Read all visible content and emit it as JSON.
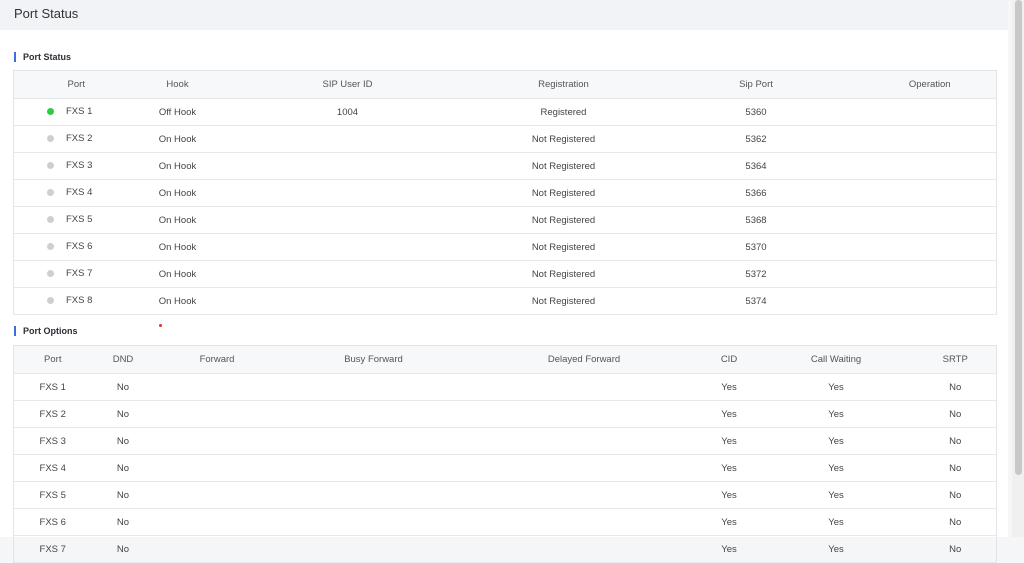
{
  "header": {
    "title": "Port Status"
  },
  "port_status": {
    "section_title": "Port Status",
    "columns": [
      "Port",
      "Hook",
      "SIP User ID",
      "Registration",
      "Sip Port",
      "Operation"
    ],
    "rows": [
      {
        "port": "FXS 1",
        "hook": "Off Hook",
        "sip_user_id": "1004",
        "registration": "Registered",
        "sip_port": "5360",
        "operation": "",
        "led_color": "#2ecc40"
      },
      {
        "port": "FXS 2",
        "hook": "On Hook",
        "sip_user_id": "",
        "registration": "Not Registered",
        "sip_port": "5362",
        "operation": "",
        "led_color": "#cfcfcf"
      },
      {
        "port": "FXS 3",
        "hook": "On Hook",
        "sip_user_id": "",
        "registration": "Not Registered",
        "sip_port": "5364",
        "operation": "",
        "led_color": "#cfcfcf"
      },
      {
        "port": "FXS 4",
        "hook": "On Hook",
        "sip_user_id": "",
        "registration": "Not Registered",
        "sip_port": "5366",
        "operation": "",
        "led_color": "#cfcfcf"
      },
      {
        "port": "FXS 5",
        "hook": "On Hook",
        "sip_user_id": "",
        "registration": "Not Registered",
        "sip_port": "5368",
        "operation": "",
        "led_color": "#cfcfcf"
      },
      {
        "port": "FXS 6",
        "hook": "On Hook",
        "sip_user_id": "",
        "registration": "Not Registered",
        "sip_port": "5370",
        "operation": "",
        "led_color": "#cfcfcf"
      },
      {
        "port": "FXS 7",
        "hook": "On Hook",
        "sip_user_id": "",
        "registration": "Not Registered",
        "sip_port": "5372",
        "operation": "",
        "led_color": "#cfcfcf"
      },
      {
        "port": "FXS 8",
        "hook": "On Hook",
        "sip_user_id": "",
        "registration": "Not Registered",
        "sip_port": "5374",
        "operation": "",
        "led_color": "#cfcfcf"
      }
    ]
  },
  "port_options": {
    "section_title": "Port Options",
    "columns": [
      "Port",
      "DND",
      "Forward",
      "Busy Forward",
      "Delayed Forward",
      "CID",
      "Call Waiting",
      "SRTP"
    ],
    "rows": [
      {
        "port": "FXS 1",
        "dnd": "No",
        "forward": "",
        "busy_forward": "",
        "delayed_forward": "",
        "cid": "Yes",
        "call_waiting": "Yes",
        "srtp": "No"
      },
      {
        "port": "FXS 2",
        "dnd": "No",
        "forward": "",
        "busy_forward": "",
        "delayed_forward": "",
        "cid": "Yes",
        "call_waiting": "Yes",
        "srtp": "No"
      },
      {
        "port": "FXS 3",
        "dnd": "No",
        "forward": "",
        "busy_forward": "",
        "delayed_forward": "",
        "cid": "Yes",
        "call_waiting": "Yes",
        "srtp": "No"
      },
      {
        "port": "FXS 4",
        "dnd": "No",
        "forward": "",
        "busy_forward": "",
        "delayed_forward": "",
        "cid": "Yes",
        "call_waiting": "Yes",
        "srtp": "No"
      },
      {
        "port": "FXS 5",
        "dnd": "No",
        "forward": "",
        "busy_forward": "",
        "delayed_forward": "",
        "cid": "Yes",
        "call_waiting": "Yes",
        "srtp": "No"
      },
      {
        "port": "FXS 6",
        "dnd": "No",
        "forward": "",
        "busy_forward": "",
        "delayed_forward": "",
        "cid": "Yes",
        "call_waiting": "Yes",
        "srtp": "No"
      },
      {
        "port": "FXS 7",
        "dnd": "No",
        "forward": "",
        "busy_forward": "",
        "delayed_forward": "",
        "cid": "Yes",
        "call_waiting": "Yes",
        "srtp": "No"
      }
    ]
  },
  "colors": {
    "accent": "#3d6ee0",
    "registered_led": "#2ecc40",
    "idle_led": "#cfcfcf"
  }
}
